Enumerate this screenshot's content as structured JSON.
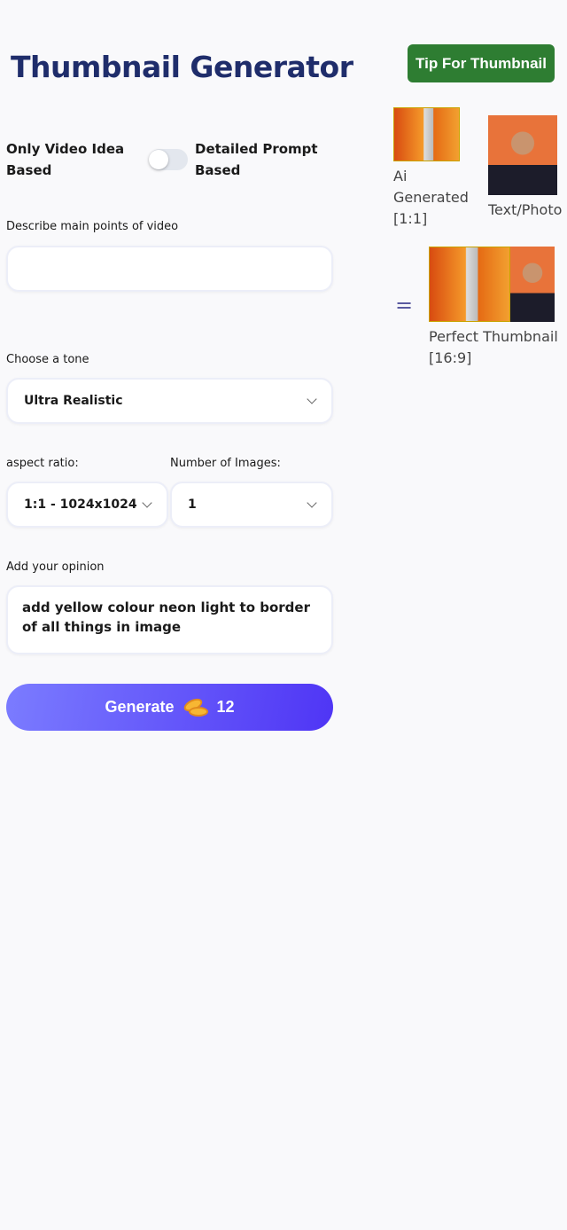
{
  "header": {
    "title": "Thumbnail Generator",
    "tip_button": "Tip For Thumbnail"
  },
  "mode": {
    "left_label_1": "Only Video Idea",
    "left_label_2": "Based",
    "right_label_1": "Detailed Prompt",
    "right_label_2": "Based",
    "toggle_on": false
  },
  "preview": {
    "ai_caption_1": "Ai",
    "ai_caption_2": "Generated",
    "ai_caption_3": "[1:1]",
    "photo_caption": "Text/Photo",
    "equals": "=",
    "result_caption_1": "Perfect Thumbnail",
    "result_caption_2": "[16:9]"
  },
  "form": {
    "describe_label": "Describe main points of video",
    "describe_value": "",
    "tone_label": "Choose a tone",
    "tone_value": "Ultra Realistic",
    "aspect_label": "aspect ratio:",
    "aspect_value": "1:1 - 1024x1024",
    "count_label": "Number of Images:",
    "count_value": "1",
    "opinion_label": "Add your opinion",
    "opinion_value": "add yellow colour neon light to border of all things in image"
  },
  "generate": {
    "label": "Generate",
    "icon": "coins-icon",
    "credits": "12"
  }
}
